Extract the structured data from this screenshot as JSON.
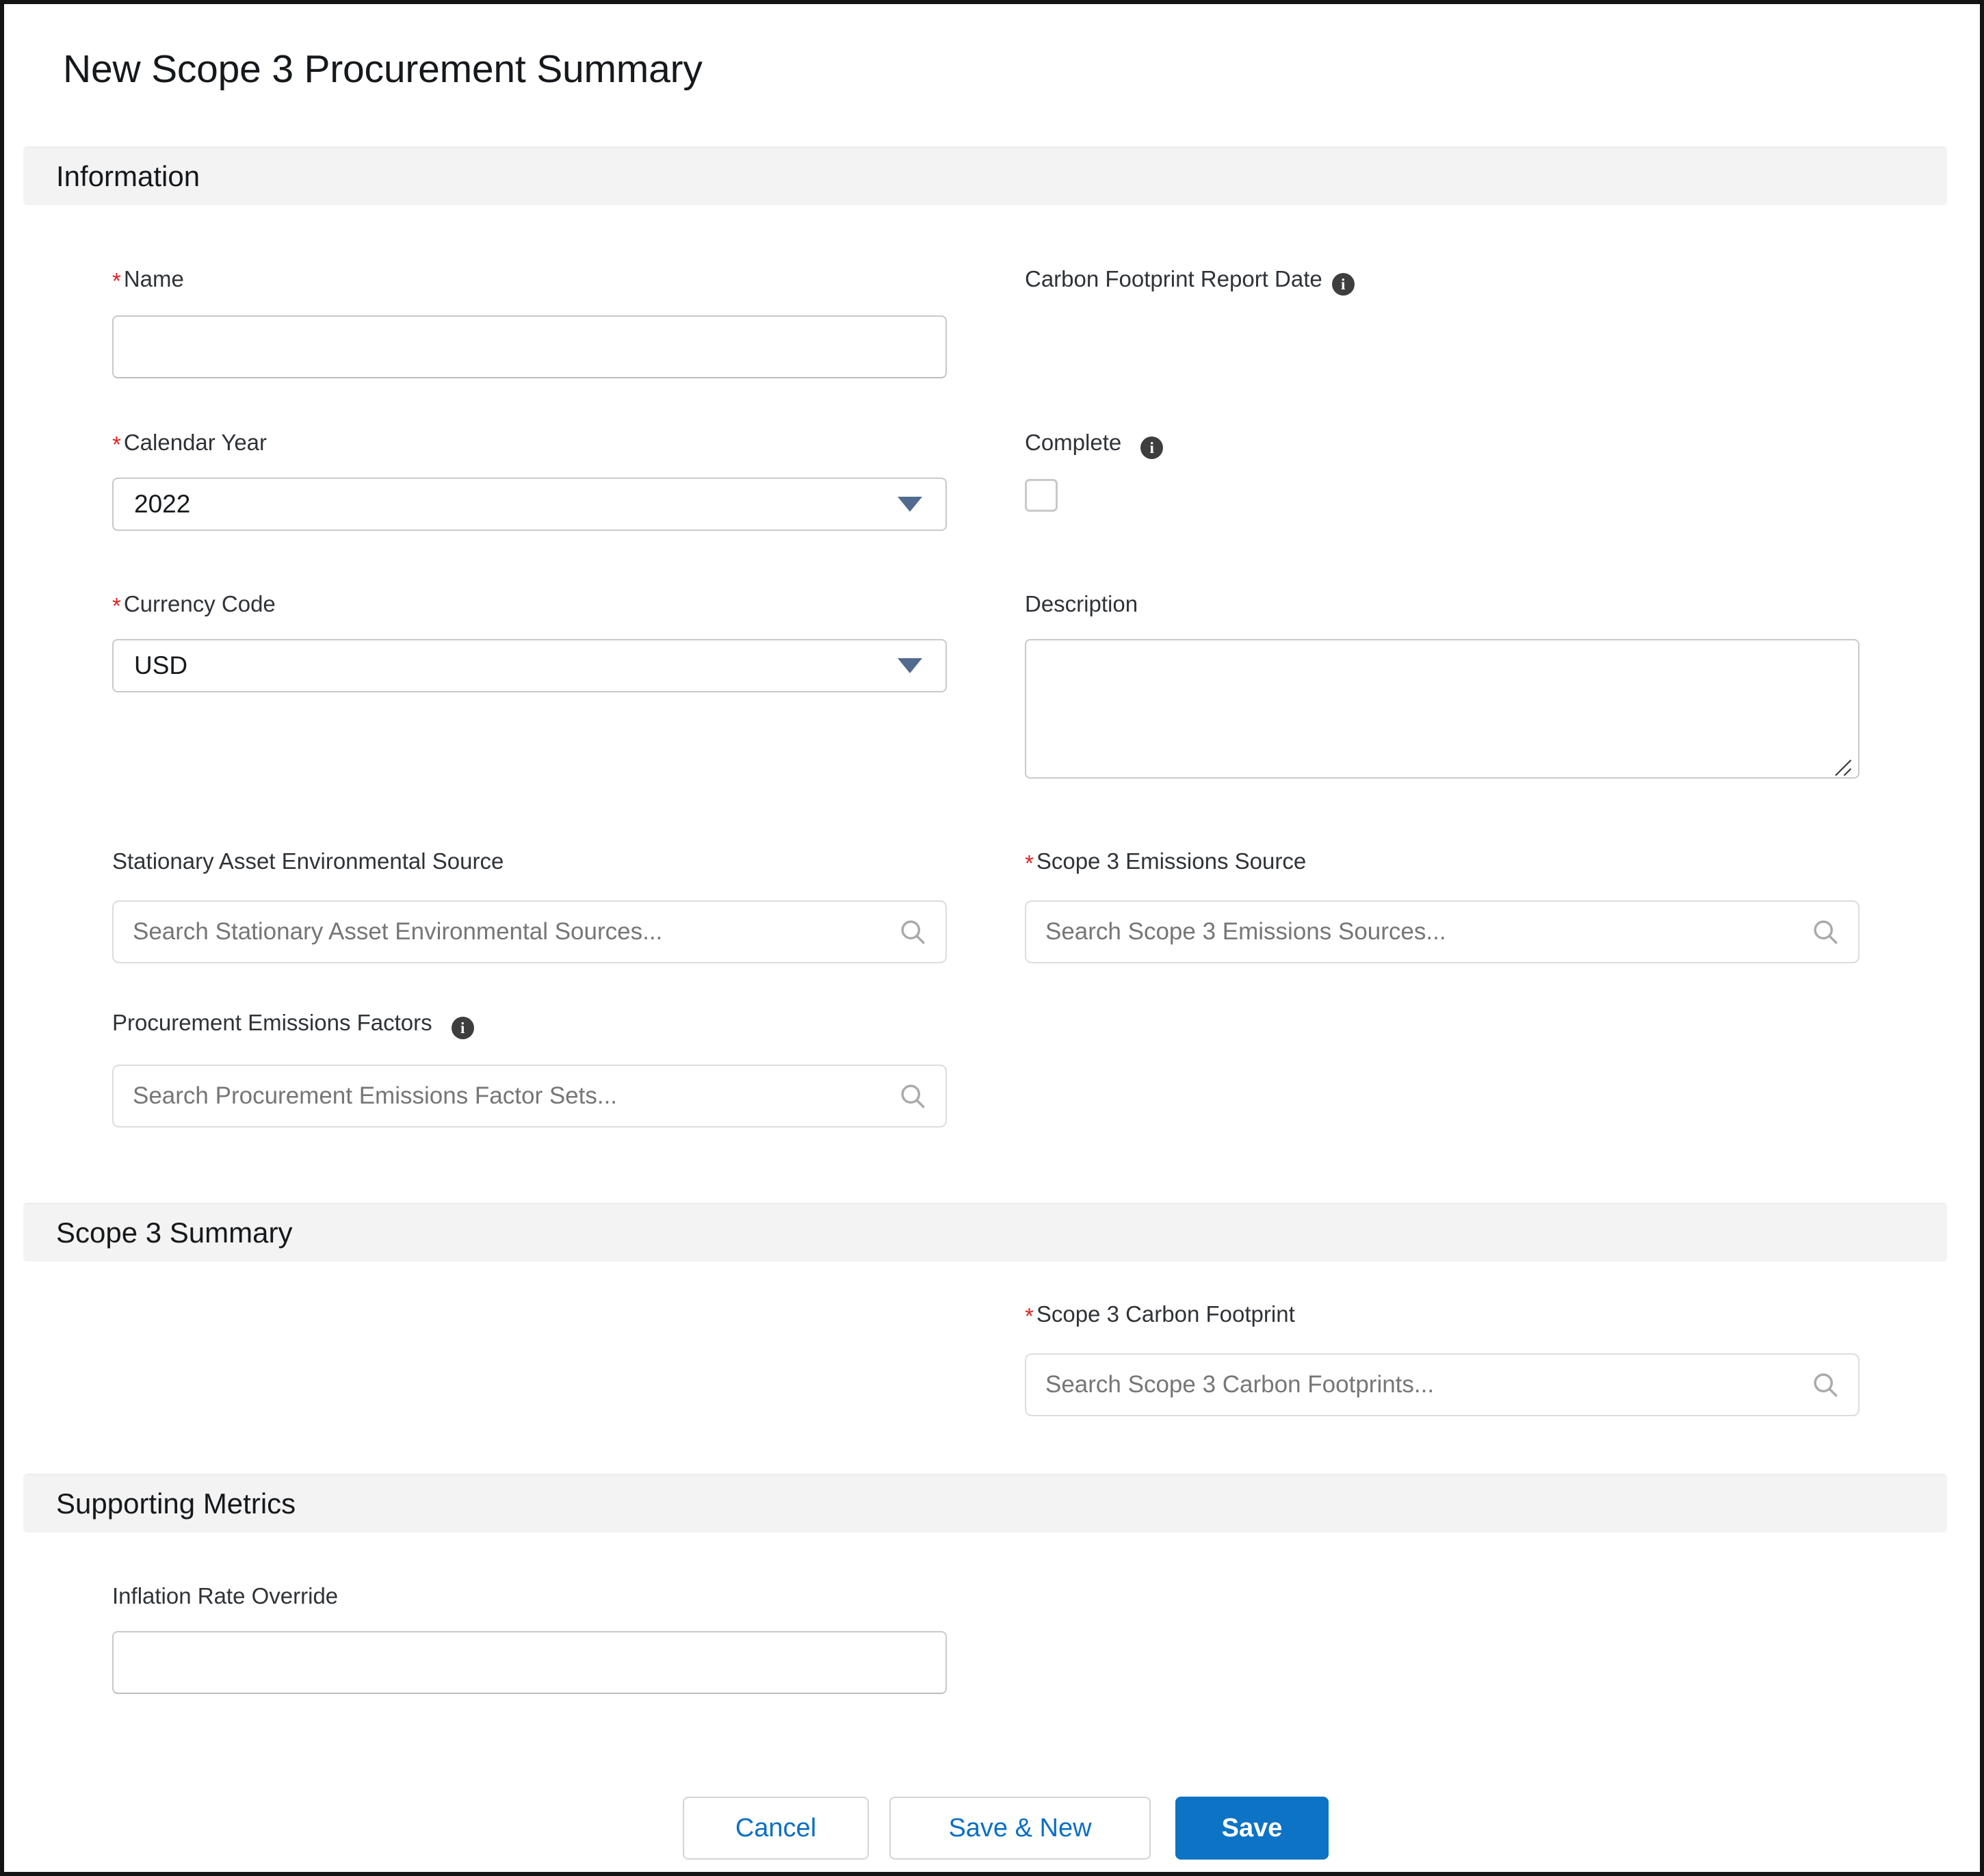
{
  "page": {
    "title": "New Scope 3 Procurement Summary"
  },
  "sections": [
    {
      "id": "information",
      "title": "Information"
    },
    {
      "id": "scope3_summary",
      "title": "Scope 3 Summary"
    },
    {
      "id": "supporting_metrics",
      "title": "Supporting Metrics"
    }
  ],
  "fields": {
    "name": {
      "label": "Name",
      "required": true,
      "value": "",
      "placeholder": ""
    },
    "calendar_year": {
      "label": "Calendar Year",
      "required": true,
      "value": "2022"
    },
    "currency_code": {
      "label": "Currency Code",
      "required": true,
      "value": "USD"
    },
    "stationary_asset_environmental_source": {
      "label": "Stationary Asset Environmental Source",
      "required": false,
      "placeholder": "Search Stationary Asset Environmental Sources..."
    },
    "procurement_emissions_factors": {
      "label": "Procurement Emissions Factors",
      "required": false,
      "has_info": true,
      "placeholder": "Search Procurement Emissions Factor Sets..."
    },
    "carbon_footprint_report_date": {
      "label": "Carbon Footprint Report Date",
      "required": false,
      "has_info": true
    },
    "complete": {
      "label": "Complete",
      "required": false,
      "has_info": true,
      "checked": false
    },
    "description": {
      "label": "Description",
      "required": false,
      "value": ""
    },
    "scope3_emissions_source": {
      "label": "Scope 3 Emissions Source",
      "required": true,
      "placeholder": "Search Scope 3 Emissions Sources..."
    },
    "scope3_carbon_footprint": {
      "label": "Scope 3 Carbon Footprint",
      "required": true,
      "placeholder": "Search Scope 3 Carbon Footprints..."
    },
    "inflation_rate_override": {
      "label": "Inflation Rate Override",
      "required": false,
      "value": ""
    }
  },
  "footer": {
    "cancel_label": "Cancel",
    "save_new_label": "Save & New",
    "save_label": "Save"
  },
  "icons": {
    "info": "i",
    "search": "search-icon",
    "dropdown": "chevron-down-icon"
  },
  "colors": {
    "required_star": "#e02020",
    "brand_blue": "#0d73c5",
    "link_blue": "#0b6fc4",
    "section_bar": "#f3f3f3",
    "info_badge": "#3e3e3e",
    "dropdown_arrow": "#516b8f"
  }
}
